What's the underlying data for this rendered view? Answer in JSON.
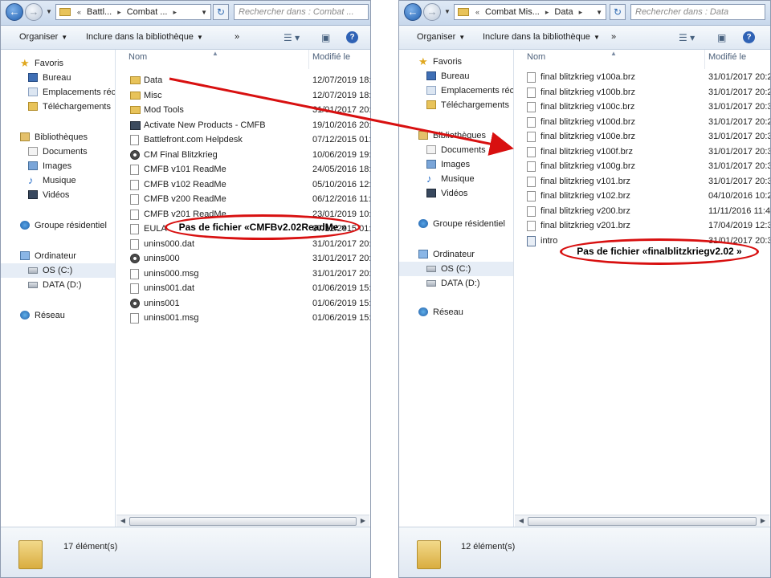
{
  "left": {
    "breadcrumb": [
      "Battl...",
      "Combat ..."
    ],
    "search_placeholder": "Rechercher dans : Combat ...",
    "toolbar": {
      "organize": "Organiser",
      "include": "Inclure dans la bibliothèque",
      "more": "»"
    },
    "nav": [
      {
        "label": "Favoris",
        "icon": "star-icon"
      },
      {
        "label": "Bureau",
        "icon": "desktop-icon"
      },
      {
        "label": "Emplacements réce",
        "icon": "recent-places-icon"
      },
      {
        "label": "Téléchargements",
        "icon": "downloads-icon"
      },
      {
        "label": "Bibliothèques",
        "icon": "libraries-icon"
      },
      {
        "label": "Documents",
        "icon": "documents-icon"
      },
      {
        "label": "Images",
        "icon": "images-icon"
      },
      {
        "label": "Musique",
        "icon": "music-icon"
      },
      {
        "label": "Vidéos",
        "icon": "videos-icon"
      },
      {
        "label": "Groupe résidentiel",
        "icon": "homegroup-icon"
      },
      {
        "label": "Ordinateur",
        "icon": "computer-icon"
      },
      {
        "label": "OS (C:)",
        "icon": "drive-icon"
      },
      {
        "label": "DATA (D:)",
        "icon": "drive-icon"
      },
      {
        "label": "Réseau",
        "icon": "network-icon"
      }
    ],
    "columns": {
      "name": "Nom",
      "modified": "Modifié le"
    },
    "files": [
      {
        "name": "Data",
        "date": "12/07/2019 18:1",
        "icon": "folder"
      },
      {
        "name": "Misc",
        "date": "12/07/2019 18:1",
        "icon": "folder"
      },
      {
        "name": "Mod Tools",
        "date": "31/01/2017 20:3",
        "icon": "folder"
      },
      {
        "name": "Activate New Products - CMFB",
        "date": "19/10/2016 20:4",
        "icon": "prog"
      },
      {
        "name": "Battlefront.com Helpdesk",
        "date": "07/12/2015 01:2",
        "icon": "file"
      },
      {
        "name": "CM Final Blitzkrieg",
        "date": "10/06/2019 19:1",
        "icon": "gear"
      },
      {
        "name": "CMFB v101 ReadMe",
        "date": "24/05/2016 18:0",
        "icon": "file"
      },
      {
        "name": "CMFB v102 ReadMe",
        "date": "05/10/2016 12:0",
        "icon": "file"
      },
      {
        "name": "CMFB v200 ReadMe",
        "date": "06/12/2016 11:2",
        "icon": "file"
      },
      {
        "name": "CMFB v201 ReadMe",
        "date": "23/01/2019 10:0",
        "icon": "file"
      },
      {
        "name": "EULA",
        "date": "07/12/2015 01:2",
        "icon": "file"
      },
      {
        "name": "unins000.dat",
        "date": "31/01/2017 20:4",
        "icon": "file"
      },
      {
        "name": "unins000",
        "date": "31/01/2017 20:4",
        "icon": "gear"
      },
      {
        "name": "unins000.msg",
        "date": "31/01/2017 20:4",
        "icon": "file"
      },
      {
        "name": "unins001.dat",
        "date": "01/06/2019 15:0",
        "icon": "file"
      },
      {
        "name": "unins001",
        "date": "01/06/2019 15:0",
        "icon": "gear"
      },
      {
        "name": "unins001.msg",
        "date": "01/06/2019 15:0",
        "icon": "file"
      }
    ],
    "status": "17 élément(s)",
    "callout": "Pas de fichier «CMFBv2.02ReadMe »"
  },
  "right": {
    "breadcrumb": [
      "Combat Mis...",
      "Data"
    ],
    "search_placeholder": "Rechercher dans : Data",
    "toolbar": {
      "organize": "Organiser",
      "include": "Inclure dans la bibliothèque",
      "more": "»"
    },
    "nav": [
      {
        "label": "Favoris",
        "icon": "star-icon"
      },
      {
        "label": "Bureau",
        "icon": "desktop-icon"
      },
      {
        "label": "Emplacements réce",
        "icon": "recent-places-icon"
      },
      {
        "label": "Téléchargements",
        "icon": "downloads-icon"
      },
      {
        "label": "Bibliothèques",
        "icon": "libraries-icon"
      },
      {
        "label": "Documents",
        "icon": "documents-icon"
      },
      {
        "label": "Images",
        "icon": "images-icon"
      },
      {
        "label": "Musique",
        "icon": "music-icon"
      },
      {
        "label": "Vidéos",
        "icon": "videos-icon"
      },
      {
        "label": "Groupe résidentiel",
        "icon": "homegroup-icon"
      },
      {
        "label": "Ordinateur",
        "icon": "computer-icon"
      },
      {
        "label": "OS (C:)",
        "icon": "drive-icon"
      },
      {
        "label": "DATA (D:)",
        "icon": "drive-icon"
      },
      {
        "label": "Réseau",
        "icon": "network-icon"
      }
    ],
    "columns": {
      "name": "Nom",
      "modified": "Modifié le"
    },
    "files": [
      {
        "name": "final blitzkrieg v100a.brz",
        "date": "31/01/2017 20:2",
        "icon": "file"
      },
      {
        "name": "final blitzkrieg v100b.brz",
        "date": "31/01/2017 20:2",
        "icon": "file"
      },
      {
        "name": "final blitzkrieg v100c.brz",
        "date": "31/01/2017 20:3",
        "icon": "file"
      },
      {
        "name": "final blitzkrieg v100d.brz",
        "date": "31/01/2017 20:2",
        "icon": "file"
      },
      {
        "name": "final blitzkrieg v100e.brz",
        "date": "31/01/2017 20:3",
        "icon": "file"
      },
      {
        "name": "final blitzkrieg v100f.brz",
        "date": "31/01/2017 20:3",
        "icon": "file"
      },
      {
        "name": "final blitzkrieg v100g.brz",
        "date": "31/01/2017 20:3",
        "icon": "file"
      },
      {
        "name": "final blitzkrieg v101.brz",
        "date": "31/01/2017 20:3",
        "icon": "file"
      },
      {
        "name": "final blitzkrieg v102.brz",
        "date": "04/10/2016 10:2",
        "icon": "file"
      },
      {
        "name": "final blitzkrieg v200.brz",
        "date": "11/11/2016 11:4",
        "icon": "file"
      },
      {
        "name": "final blitzkrieg v201.brz",
        "date": "17/04/2019 12:3",
        "icon": "file"
      },
      {
        "name": "intro",
        "date": "31/01/2017 20:3",
        "icon": "intro"
      }
    ],
    "status": "12 élément(s)",
    "callout": "Pas de fichier «finalblitzkriegv2.02 »"
  },
  "colors": {
    "callout_red": "#d81010",
    "accent_blue": "#2f62b5"
  }
}
